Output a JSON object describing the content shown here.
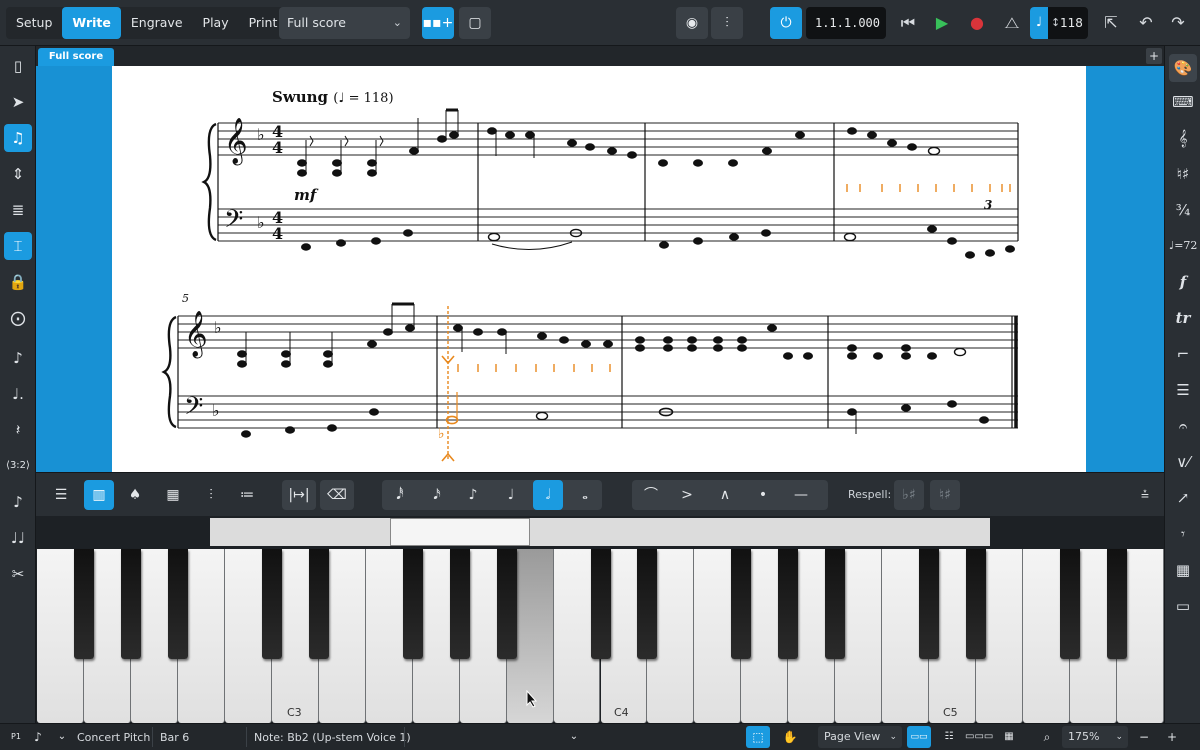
{
  "toolbar": {
    "modes": [
      "Setup",
      "Write",
      "Engrave",
      "Play",
      "Print"
    ],
    "active_mode": "Write",
    "layout_select": "Full score",
    "timecode": "1.1.1.000",
    "tempo_value": "118"
  },
  "tab": {
    "label": "Full score",
    "add": "+"
  },
  "score": {
    "tempo_text": "Swung",
    "tempo_value": "(♩ = 118)",
    "dynamic": "mf",
    "system_number": "5",
    "tuplet": "3"
  },
  "lower_toolbar": {
    "respell_label": "Respell:"
  },
  "keyboard": {
    "labels": [
      "C3",
      "C4",
      "C5"
    ]
  },
  "status": {
    "concert_pitch": "Concert Pitch",
    "bar": "Bar 6",
    "note": "Note: Bb2 (Up-stem Voice 1)",
    "view": "Page View",
    "zoom": "175%",
    "zoom_minus": "−",
    "zoom_plus": "+"
  },
  "colors": {
    "accent": "#1b9be0",
    "selection": "#e8891e",
    "score_bg": "#1891d4"
  }
}
